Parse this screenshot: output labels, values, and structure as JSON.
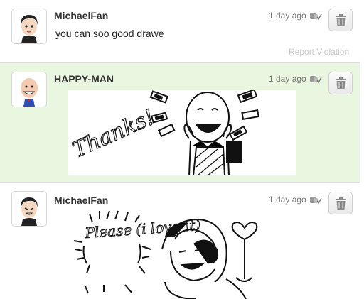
{
  "posts": [
    {
      "username": "MichaelFan",
      "text": "you can soo good drawe",
      "time": "1 day ago",
      "report_label": "Report Violation"
    },
    {
      "username": "HAPPY-MAN",
      "time": "1 day ago",
      "drawing_text": "Thanks!"
    },
    {
      "username": "MichaelFan",
      "time": "1 day ago",
      "drawing_text": "Please (i love it)"
    }
  ],
  "colors": {
    "highlight_bg": "#eaf7e0",
    "separator": "#dcdcdc",
    "muted_text": "#c8c8c8"
  },
  "icons": [
    "empathy-icon",
    "trash-icon"
  ]
}
